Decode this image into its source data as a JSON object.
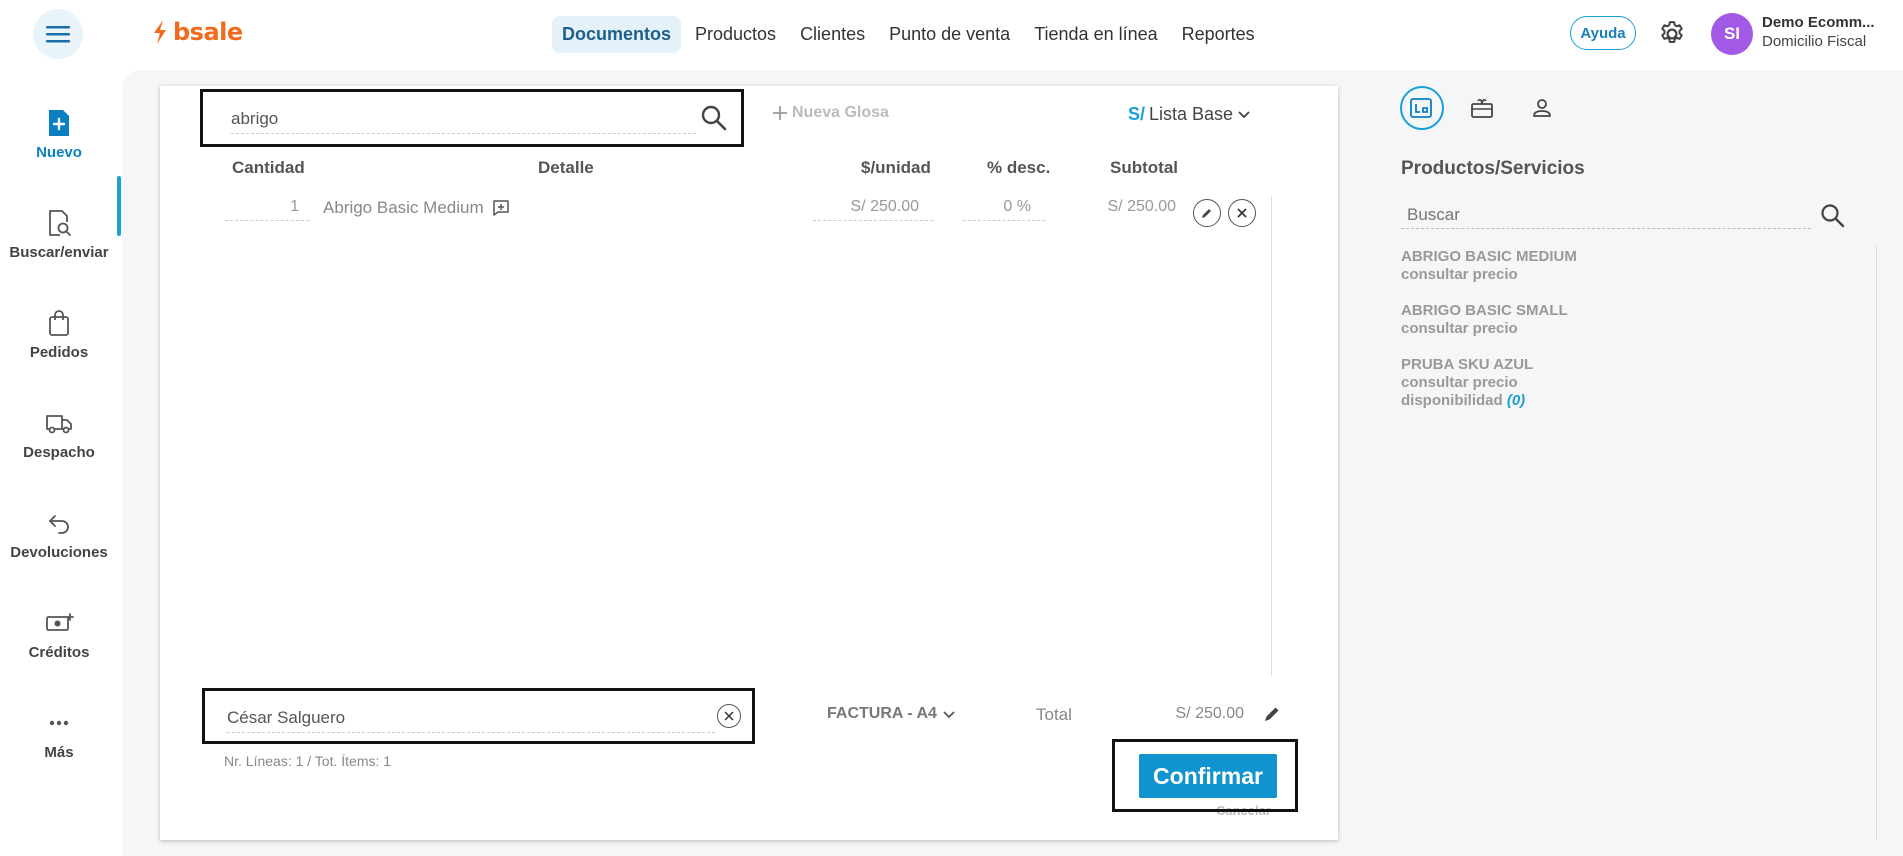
{
  "app": {
    "logo_text": "bsale",
    "brand_color": "#f26a1b",
    "accent_color": "#1a9fd6"
  },
  "nav": {
    "items": [
      "Documentos",
      "Productos",
      "Clientes",
      "Punto de venta",
      "Tienda en línea",
      "Reportes"
    ],
    "active": "Documentos"
  },
  "header": {
    "help_label": "Ayuda",
    "avatar_initials": "SI",
    "account_name": "Demo Ecomm...",
    "account_sub": "Domicilio Fiscal"
  },
  "sidebar": {
    "items": [
      {
        "label": "Nuevo",
        "icon": "new-document-icon"
      },
      {
        "label": "Buscar/enviar",
        "icon": "search-document-icon"
      },
      {
        "label": "Pedidos",
        "icon": "bag-icon"
      },
      {
        "label": "Despacho",
        "icon": "truck-icon"
      },
      {
        "label": "Devoluciones",
        "icon": "return-icon"
      },
      {
        "label": "Créditos",
        "icon": "money-icon"
      },
      {
        "label": "Más",
        "icon": "more-icon"
      }
    ]
  },
  "document": {
    "search_value": "abrigo",
    "nueva_glosa": "Nueva Glosa",
    "price_list_currency": "S/",
    "price_list_name": "Lista Base",
    "columns": {
      "qty": "Cantidad",
      "detail": "Detalle",
      "unit_price": "$/unidad",
      "discount": "% desc.",
      "subtotal": "Subtotal"
    },
    "lines": [
      {
        "qty": "1",
        "detail": "Abrigo Basic Medium",
        "unit_price": "S/ 250.00",
        "discount": "0 %",
        "subtotal": "S/ 250.00"
      }
    ],
    "client_value": "César Salguero",
    "doc_type": "FACTURA - A4",
    "total_label": "Total",
    "total_value": "S/ 250.00",
    "counts": "Nr. Líneas: 1 / Tot. Ítems: 1",
    "confirm_label": "Confirmar",
    "cancel_label": "Cancelar"
  },
  "right_panel": {
    "title": "Productos/Servicios",
    "search_placeholder": "Buscar",
    "products": [
      {
        "name": "ABRIGO BASIC MEDIUM",
        "price": "consultar precio"
      },
      {
        "name": "ABRIGO BASIC SMALL",
        "price": "consultar precio"
      },
      {
        "name": "PRUBA SKU AZUL",
        "price": "consultar precio",
        "availability_label": "disponibilidad",
        "availability_value": "(0)"
      }
    ]
  }
}
